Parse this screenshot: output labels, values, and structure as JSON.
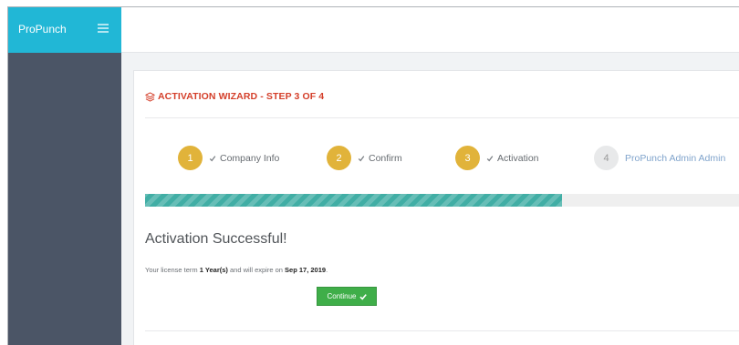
{
  "topbar": {
    "brand": "ProPunch",
    "menu_icon": "hamburger-menu-icon"
  },
  "wizard": {
    "title": "ACTIVATION WIZARD - STEP 3 OF 4",
    "title_icon": "layers-icon",
    "steps": [
      {
        "number": "1",
        "label": "Company Info",
        "state": "done"
      },
      {
        "number": "2",
        "label": "Confirm",
        "state": "done"
      },
      {
        "number": "3",
        "label": "Activation",
        "state": "done"
      },
      {
        "number": "4",
        "label": "ProPunch Admin Admin",
        "state": "pending"
      }
    ],
    "progress_percent": 70
  },
  "result": {
    "title": "Activation Successful!",
    "license_prefix": "Your license term ",
    "license_term": "1 Year(s)",
    "license_middle": " and will expire on ",
    "license_expiry": "Sep 17, 2019",
    "license_suffix": ".",
    "continue_label": "Continue"
  },
  "colors": {
    "brand": "#21b7d6",
    "sidebar": "#4b5566",
    "step_done": "#e1b33a",
    "progress": "#41aea5",
    "title_red": "#d43f2a",
    "continue_green": "#3fae49"
  }
}
